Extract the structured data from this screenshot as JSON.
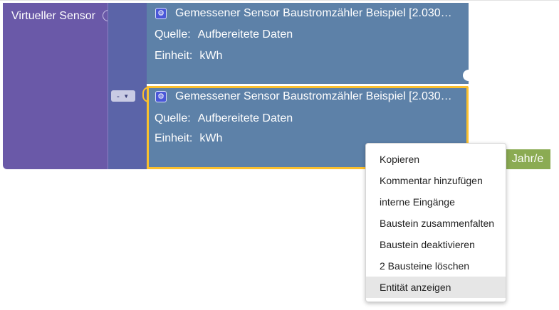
{
  "outer_block": {
    "label": "Virtueller Sensor",
    "color": "#6a59a8"
  },
  "middle_block": {
    "dropdown_value": "-",
    "dropdown_arrow": "▼",
    "color": "#5b64a8"
  },
  "sensors": [
    {
      "title": "Gemessener Sensor Baustromzähler Beispiel [2.030…",
      "source_label": "Quelle:",
      "source_value": "Aufbereitete Daten",
      "unit_label": "Einheit:",
      "unit_value": "kWh",
      "icon": "gear-icon",
      "selected": false
    },
    {
      "title": "Gemessener Sensor Baustromzähler Beispiel [2.030…",
      "source_label": "Quelle:",
      "source_value": "Aufbereitete Daten",
      "unit_label": "Einheit:",
      "unit_value": "kWh",
      "icon": "gear-icon",
      "selected": true
    }
  ],
  "period_block": {
    "label": "Jahr/e",
    "color": "#8bab53"
  },
  "context_menu": {
    "items": [
      {
        "label": "Kopieren"
      },
      {
        "label": "Kommentar hinzufügen"
      },
      {
        "label": "interne Eingänge"
      },
      {
        "label": "Baustein zusammenfalten"
      },
      {
        "label": "Baustein deaktivieren"
      },
      {
        "label": "2 Bausteine löschen"
      },
      {
        "label": "Entität anzeigen",
        "hovered": true
      }
    ]
  },
  "colors": {
    "sensor_block": "#5d81a8",
    "selection": "#fbc02d"
  }
}
